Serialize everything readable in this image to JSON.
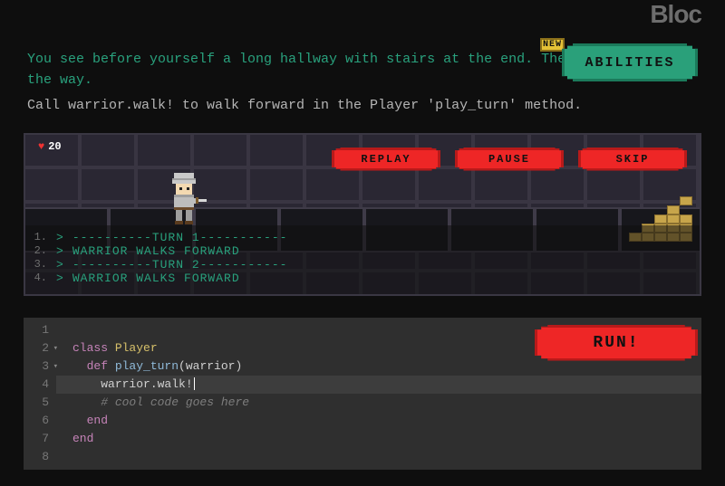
{
  "brand": "Bloc",
  "instructions": {
    "flavor": "You see before yourself a long hallway with stairs at the end. There is nothing in the way.",
    "hint": "Call warrior.walk! to walk forward in the Player 'play_turn' method."
  },
  "abilities": {
    "label": "ABILITIES",
    "new_badge": "NEW"
  },
  "hp": {
    "value": "20"
  },
  "controls": {
    "replay": "REPLAY",
    "pause": "PAUSE",
    "skip": "SKIP"
  },
  "log": [
    {
      "n": "1.",
      "text": "----------TURN 1-----------"
    },
    {
      "n": "2.",
      "text": "WARRIOR WALKS FORWARD"
    },
    {
      "n": "3.",
      "text": "----------TURN 2-----------"
    },
    {
      "n": "4.",
      "text": "WARRIOR WALKS FORWARD"
    }
  ],
  "editor": {
    "lines": [
      "1",
      "2",
      "3",
      "4",
      "5",
      "6",
      "7",
      "8"
    ],
    "code": {
      "l2_kw": "class ",
      "l2_cls": "Player",
      "l3_kw": "def ",
      "l3_fn": "play_turn",
      "l3_args": "(warrior)",
      "l4": "warrior.walk!",
      "l5": "# cool code goes here",
      "l6": "end",
      "l7": "end"
    }
  },
  "run": {
    "label": "RUN!"
  }
}
